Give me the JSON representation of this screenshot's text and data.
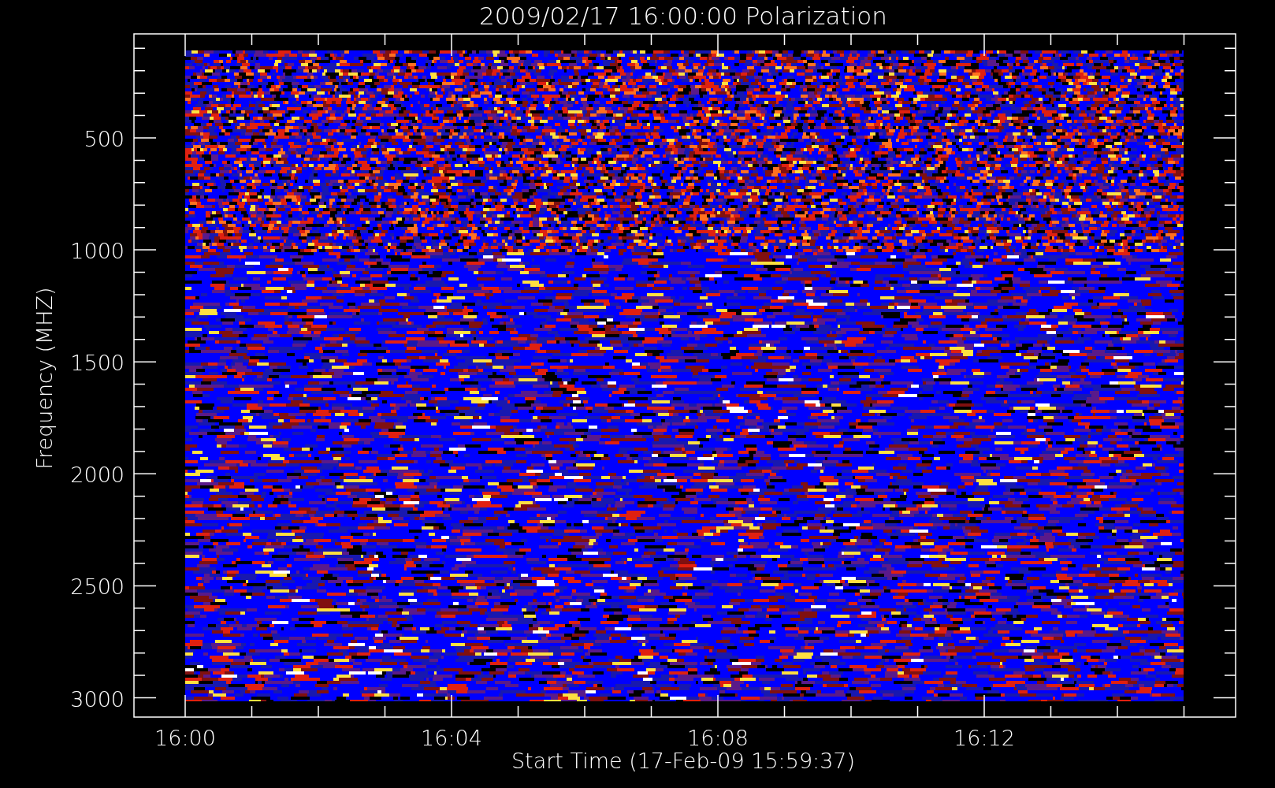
{
  "title": "2009/02/17 16:00:00 Polarization",
  "y_axis": {
    "label": "Frequency (MHZ)",
    "ticks": [
      "500",
      "1000",
      "1500",
      "2000",
      "2500",
      "3000"
    ]
  },
  "x_axis": {
    "label": "Start Time (17-Feb-09 15:59:37)",
    "ticks": [
      "16:00",
      "16:04",
      "16:08",
      "16:12"
    ]
  }
}
